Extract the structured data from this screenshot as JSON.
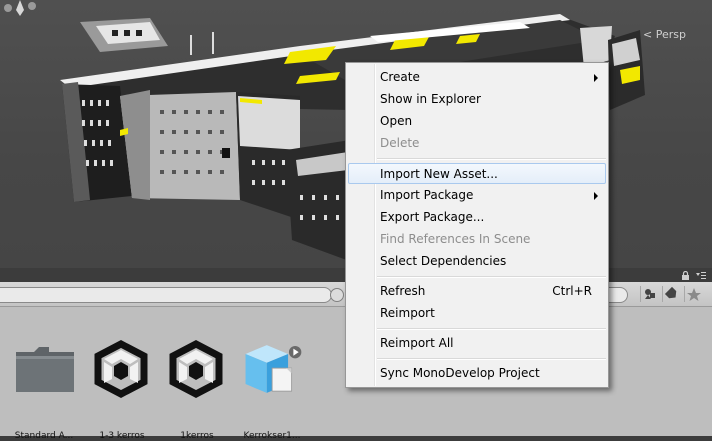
{
  "scene": {
    "projection_label": "< Persp"
  },
  "context_menu": {
    "items": [
      {
        "label": "Create",
        "submenu": true
      },
      {
        "label": "Show in Explorer"
      },
      {
        "label": "Open"
      },
      {
        "label": "Delete",
        "disabled": true
      },
      {
        "label": "Import New Asset...",
        "highlighted": true
      },
      {
        "label": "Import Package",
        "submenu": true
      },
      {
        "label": "Export Package..."
      },
      {
        "label": "Find References In Scene",
        "disabled": true
      },
      {
        "label": "Select Dependencies"
      },
      {
        "label": "Refresh",
        "shortcut": "Ctrl+R"
      },
      {
        "label": "Reimport"
      },
      {
        "label": "Reimport All"
      },
      {
        "label": "Sync MonoDevelop Project"
      }
    ]
  },
  "project": {
    "assets": [
      {
        "label": "Standard A...",
        "icon": "folder-icon"
      },
      {
        "label": "1-3 kerros",
        "icon": "unity-scene-icon"
      },
      {
        "label": "1kerros",
        "icon": "unity-scene-icon"
      },
      {
        "label": "Kerrokser1...",
        "icon": "model-prefab-icon"
      }
    ]
  },
  "colors": {
    "scene_bg": "#4a4a4a",
    "highlight_yellow": "#f2e800",
    "menu_bg": "#f1f1f1",
    "menu_highlight_border": "#a9c9ee",
    "project_bg": "#bebebe"
  }
}
